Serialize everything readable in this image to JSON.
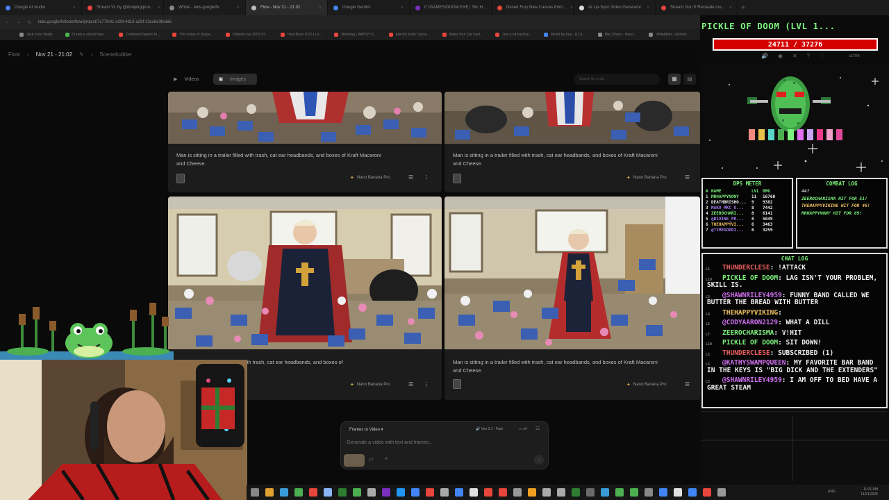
{
  "browser": {
    "tabs": [
      {
        "label": "Google AI studio",
        "color": "#4285f4"
      },
      {
        "label": "Stream VL by @donpikgrpun...",
        "color": "#e8453c"
      },
      {
        "label": "Whisk - labs.google/fx",
        "color": "#888888"
      },
      {
        "label": "Flow - Nov 21 - 21:02",
        "color": "#bbbbbb"
      },
      {
        "label": "Google Gemini",
        "color": "#4285f4"
      },
      {
        "label": "C:\\GAMES\\DOOM.EXE | Tim H...",
        "color": "#7b2fbe"
      },
      {
        "label": "Desert Fury New Canvas Print...",
        "color": "#e8453c"
      },
      {
        "label": "AI Lip-Sync Video Generator",
        "color": "#dddddd"
      },
      {
        "label": "Stream Don P Recreate mu...",
        "color": "#e8453c"
      }
    ],
    "new_tab": "+",
    "url": "labs.google/fx/tools/flow/project/7c77fc41-e2fd-4d13-a26f-23cc6e3fea66",
    "bookmarks": [
      {
        "label": "Jack Frost Radio",
        "color": "#888888"
      },
      {
        "label": "Create a sound New...",
        "color": "#4caf50"
      },
      {
        "label": "Combined Speed Te...",
        "color": "#e8453c"
      },
      {
        "label": "The colors of Dyspe...",
        "color": "#e8453c"
      },
      {
        "label": "Defjam Live 2013 | H...",
        "color": "#e8453c"
      },
      {
        "label": "Hard Bass 2013 | Lo...",
        "color": "#e8453c"
      },
      {
        "label": "Moontag | WATCH D...",
        "color": "#e8453c"
      },
      {
        "label": "Electric Fairy Canva...",
        "color": "#e8453c"
      },
      {
        "label": "Make Your Car Fast...",
        "color": "#e8453c"
      },
      {
        "label": "Just a bit Factory...",
        "color": "#e8453c"
      },
      {
        "label": "Mixed by Key - DJ S...",
        "color": "#4285f4"
      },
      {
        "label": "Mar Cifuen - Impur...",
        "color": "#888888"
      },
      {
        "label": "VMtabbles - Richew...",
        "color": "#888888"
      }
    ]
  },
  "header": {
    "crumb_root": "Flow",
    "crumb_sep": "›",
    "crumb_project": "Nov 21 - 21:02",
    "edit_icon": "✎",
    "crumb_tool": "Scenebuilder"
  },
  "toolbar": {
    "videos_label": "Videos",
    "images_label": "Images",
    "search_placeholder": "Search for a clip",
    "grid_icon": "▦",
    "list_icon": "▤"
  },
  "cards": [
    {
      "caption": "Man is sitting in a trailer filled with trash, cat ear headbands, and boxes of Kraft Macaroni and Cheese.",
      "model": "Nano Banana Pro"
    },
    {
      "caption": "Man is sitting in a trailer filled with trash, cat ear headbands, and boxes of Kraft Macaroni and Cheese.",
      "model": "Nano Banana Pro"
    },
    {
      "caption": "...with trash, cat ear headbands, and boxes of",
      "model": "Nano Banana Pro"
    },
    {
      "caption": "Man is sitting in a trailer filled with trash, cat ear headbands, and boxes of Kraft Macaroni and Cheese.",
      "model": "Nano Banana Pro"
    }
  ],
  "composer": {
    "mode": "Frames to Video",
    "model": "Veo 3.1 - Fast",
    "count": "x4",
    "placeholder": "Generate a video with text and frames..."
  },
  "overlay": {
    "title": "PICKLE OF DOOM (LVL 1...",
    "hp": "24711 / 37276",
    "hp_fraction": 0.663,
    "quality": "ULTRA",
    "dps": {
      "title": "DPS METER",
      "headers": [
        "#",
        "NAME",
        "LVL",
        "DMG"
      ],
      "rows": [
        {
          "n": "1",
          "name": "MRHAPPYNONY",
          "lvl": "11",
          "dmg": "16760",
          "color": "#7ef27e"
        },
        {
          "n": "2",
          "name": "DEATHBRISHO...",
          "lvl": "9",
          "dmg": "9382",
          "color": "#f0f0f0"
        },
        {
          "n": "3",
          "name": "MAKO_MKC_O...",
          "lvl": "8",
          "dmg": "7442",
          "color": "#a97ff5"
        },
        {
          "n": "4",
          "name": "ZEEROCHARI...",
          "lvl": "8",
          "dmg": "6141",
          "color": "#7ef27e"
        },
        {
          "n": "5",
          "name": "@DIVINE_PR...",
          "lvl": "8",
          "dmg": "5049",
          "color": "#a97ff5"
        },
        {
          "n": "6",
          "name": "THEHAPPYVI...",
          "lvl": "6",
          "dmg": "3463",
          "color": "#f0c060"
        },
        {
          "n": "7",
          "name": "@TIMEGODDI...",
          "lvl": "6",
          "dmg": "3259",
          "color": "#a97ff5"
        }
      ]
    },
    "combat": {
      "title": "COMBAT LOG",
      "lines": [
        {
          "text": "44?",
          "color": "#cccccc"
        },
        {
          "text": "ZEEROCHARISMA HIT FOR 51!",
          "color": "#7ef27e"
        },
        {
          "text": "THEHAPPYVIKING HIT FOR 46!",
          "color": "#f0c060"
        },
        {
          "text": "MRHAPPYNONY HIT FOR 69!",
          "color": "#7ef27e"
        }
      ]
    },
    "chat": {
      "title": "CHAT LOG",
      "lines": [
        {
          "lvl": "L5",
          "user": "THUNDERCLESE",
          "msg": "!ATTACK",
          "color": "#f06060"
        },
        {
          "lvl": "L10",
          "user": "PICKLE OF DOOM",
          "msg": "LAG ISN'T YOUR PROBLEM, SKILL IS.",
          "color": "#7ef27e"
        },
        {
          "lvl": "L5",
          "user": "@SHAWNRILEY4959",
          "msg": "FUNNY BAND CALLED WE BUTTER THE BREAD WITH BUTTER",
          "color": "#d070f0"
        },
        {
          "lvl": "L6",
          "user": "THEHAPPYVIKING",
          "msg": "",
          "color": "#f0c060"
        },
        {
          "lvl": "L5",
          "user": "@CODYAARON2129",
          "msg": "WHAT A DILL",
          "color": "#d070f0"
        },
        {
          "lvl": "L7",
          "user": "ZEEROCHARISMA",
          "msg": "V!HIT",
          "color": "#7ef27e"
        },
        {
          "lvl": "L10",
          "user": "PICKLE OF DOOM",
          "msg": "SIT DOWN!",
          "color": "#7ef27e"
        },
        {
          "lvl": "L5",
          "user": "THUNDERCLESE",
          "msg": "SUBSCRIBED (1)",
          "color": "#f06060"
        },
        {
          "lvl": "L5",
          "user": "@KATHYSWAMPQUEEN",
          "msg": "MY FAVORITE BAR BAND IN THE KEYS IS \"BIG DICK AND THE EXTENDERS\"",
          "color": "#d070f0"
        },
        {
          "lvl": "L5",
          "user": "@SHAWNRILEY4959",
          "msg": "I AM OFF TO BED HAVE A GREAT STEAM",
          "color": "#d070f0"
        }
      ]
    }
  },
  "tray": {
    "lang": "ENG",
    "time": "11:01 PM",
    "date": "11/21/2025"
  }
}
